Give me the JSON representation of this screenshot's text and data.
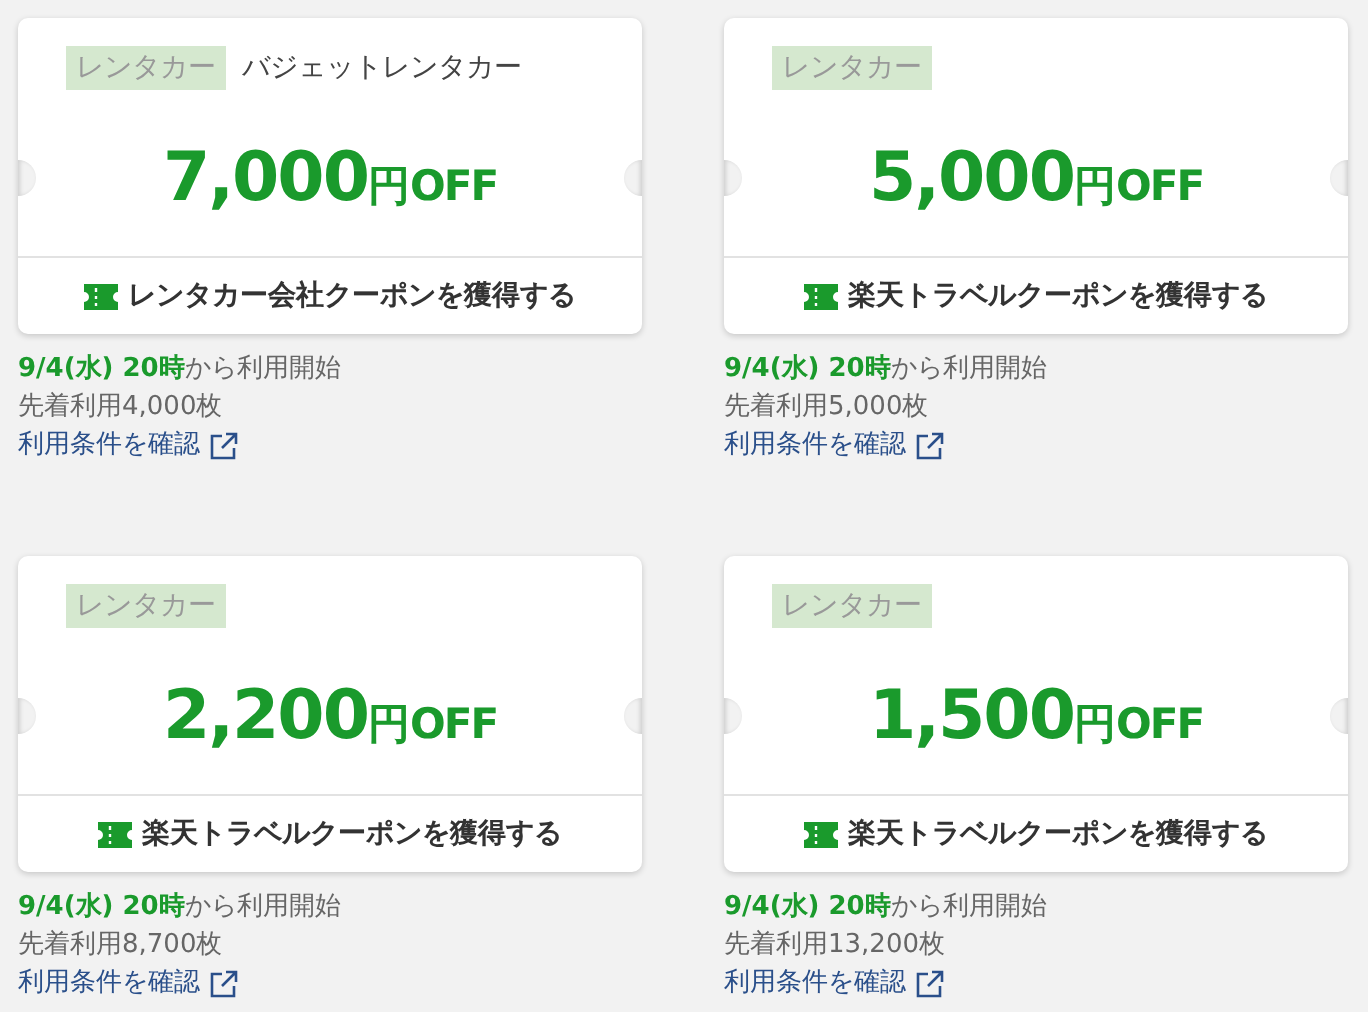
{
  "coupons": [
    {
      "tag": "レンタカー",
      "company": "バジェットレンタカー",
      "amount": "7,000",
      "unit": "円",
      "suffix": "OFF",
      "action": "レンタカー会社クーポンを獲得する",
      "start": "**9/4(水) 20時**から利用開始",
      "limit": "先着利用4,000枚",
      "terms": "利用条件を確認"
    },
    {
      "tag": "レンタカー",
      "amount": "5,000",
      "unit": "円",
      "suffix": "OFF",
      "action": "楽天トラベルクーポンを獲得する",
      "start": "**9/4(水) 20時**から利用開始",
      "limit": "先着利用5,000枚",
      "terms": "利用条件を確認"
    },
    {
      "tag": "レンタカー",
      "amount": "2,200",
      "unit": "円",
      "suffix": "OFF",
      "action": "楽天トラベルクーポンを獲得する",
      "start": "**9/4(水) 20時**から利用開始",
      "limit": "先着利用8,700枚",
      "terms": "利用条件を確認"
    },
    {
      "tag": "レンタカー",
      "amount": "1,500",
      "unit": "円",
      "suffix": "OFF",
      "action": "楽天トラベルクーポンを獲得する",
      "start": "**9/4(水) 20時**から利用開始",
      "limit": "先着利用13,200枚",
      "terms": "利用条件を確認"
    }
  ]
}
